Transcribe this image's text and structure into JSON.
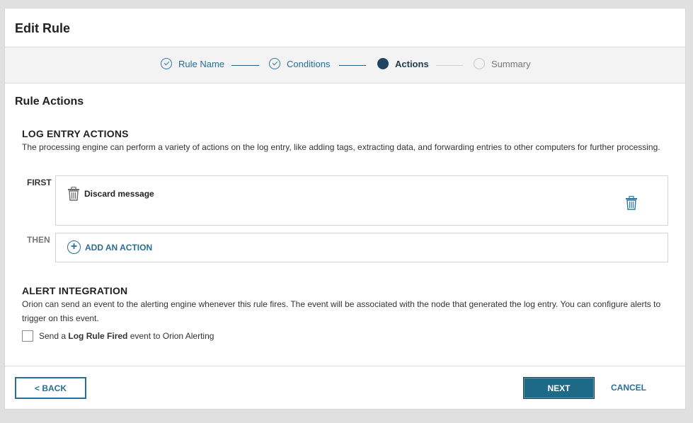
{
  "header": {
    "title": "Edit Rule"
  },
  "wizard": {
    "steps": [
      {
        "label": "Rule Name",
        "state": "done"
      },
      {
        "label": "Conditions",
        "state": "done"
      },
      {
        "label": "Actions",
        "state": "active"
      },
      {
        "label": "Summary",
        "state": "todo"
      }
    ]
  },
  "section": {
    "title": "Rule Actions"
  },
  "log_entry": {
    "heading": "LOG ENTRY ACTIONS",
    "description": "The processing engine can perform a variety of actions on the log entry, like adding tags, extracting data, and forwarding entries to other computers for further processing.",
    "first_label": "FIRST",
    "first_action": "Discard message",
    "then_label": "THEN",
    "add_action_label": "ADD AN ACTION"
  },
  "alert": {
    "heading": "ALERT INTEGRATION",
    "description": "Orion can send an event to the alerting engine whenever this rule fires. The event will be associated with the node that generated the log entry. You can configure alerts to trigger on this event.",
    "checkbox_prefix": "Send a ",
    "checkbox_bold": "Log Rule Fired",
    "checkbox_suffix": " event to Orion Alerting",
    "checked": false
  },
  "footer": {
    "back_label": "< BACK",
    "next_label": "NEXT",
    "cancel_label": "CANCEL"
  },
  "colors": {
    "accent": "#2a6e96",
    "primary_button": "#1d6986",
    "active_step": "#20455e"
  },
  "icons": {
    "done_step": "check-circle-icon",
    "action": "trash-icon",
    "delete": "trash-icon",
    "add": "plus-circle-icon"
  }
}
